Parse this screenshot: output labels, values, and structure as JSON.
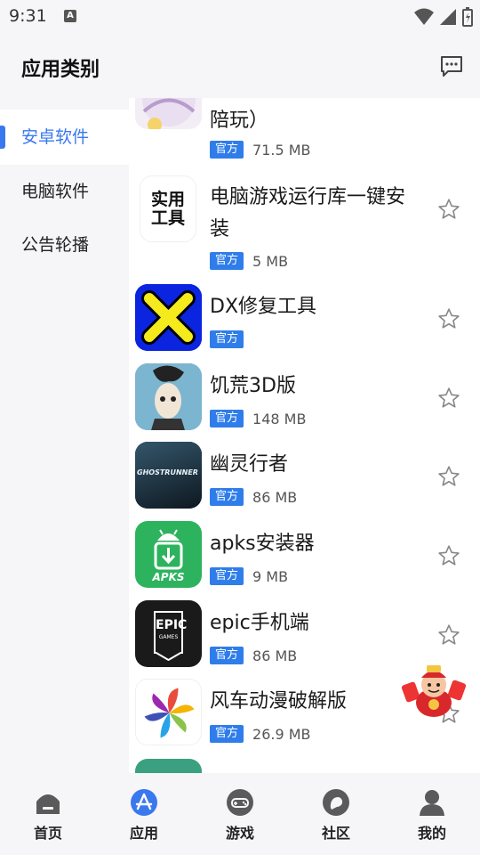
{
  "status": {
    "time": "9:31",
    "a_icon": "A"
  },
  "header": {
    "title": "应用类别",
    "message_icon": "message-icon"
  },
  "sidebar": {
    "items": [
      {
        "label": "安卓软件",
        "active": true
      },
      {
        "label": "电脑软件",
        "active": false
      },
      {
        "label": "公告轮播",
        "active": false
      }
    ]
  },
  "apps": [
    {
      "name": "陪玩）",
      "badge": "官方",
      "size": "71.5 MB"
    },
    {
      "name": "电脑游戏运行库一键安装",
      "badge": "官方",
      "size": "5 MB",
      "icon_text_1": "实用",
      "icon_text_2": "工具"
    },
    {
      "name": "DX修复工具",
      "badge": "官方",
      "size": ""
    },
    {
      "name": "饥荒3D版",
      "badge": "官方",
      "size": "148 MB"
    },
    {
      "name": "幽灵行者",
      "badge": "官方",
      "size": "86 MB",
      "icon_text": "GHOSTRUNNER"
    },
    {
      "name": "apks安装器",
      "badge": "官方",
      "size": "9 MB",
      "icon_text": "APKS"
    },
    {
      "name": "epic手机端",
      "badge": "官方",
      "size": "86 MB",
      "icon_text_1": "EPIC",
      "icon_text_2": "GAMES"
    },
    {
      "name": "风车动漫破解版",
      "badge": "官方",
      "size": "26.9 MB"
    }
  ],
  "bottom_nav": [
    {
      "label": "首页",
      "icon": "home-icon"
    },
    {
      "label": "应用",
      "icon": "app-store-icon",
      "active": true
    },
    {
      "label": "游戏",
      "icon": "gamepad-icon"
    },
    {
      "label": "社区",
      "icon": "chat-bubble-icon"
    },
    {
      "label": "我的",
      "icon": "user-icon"
    }
  ],
  "colors": {
    "accent": "#3a78ee",
    "badge": "#2f7dea"
  }
}
